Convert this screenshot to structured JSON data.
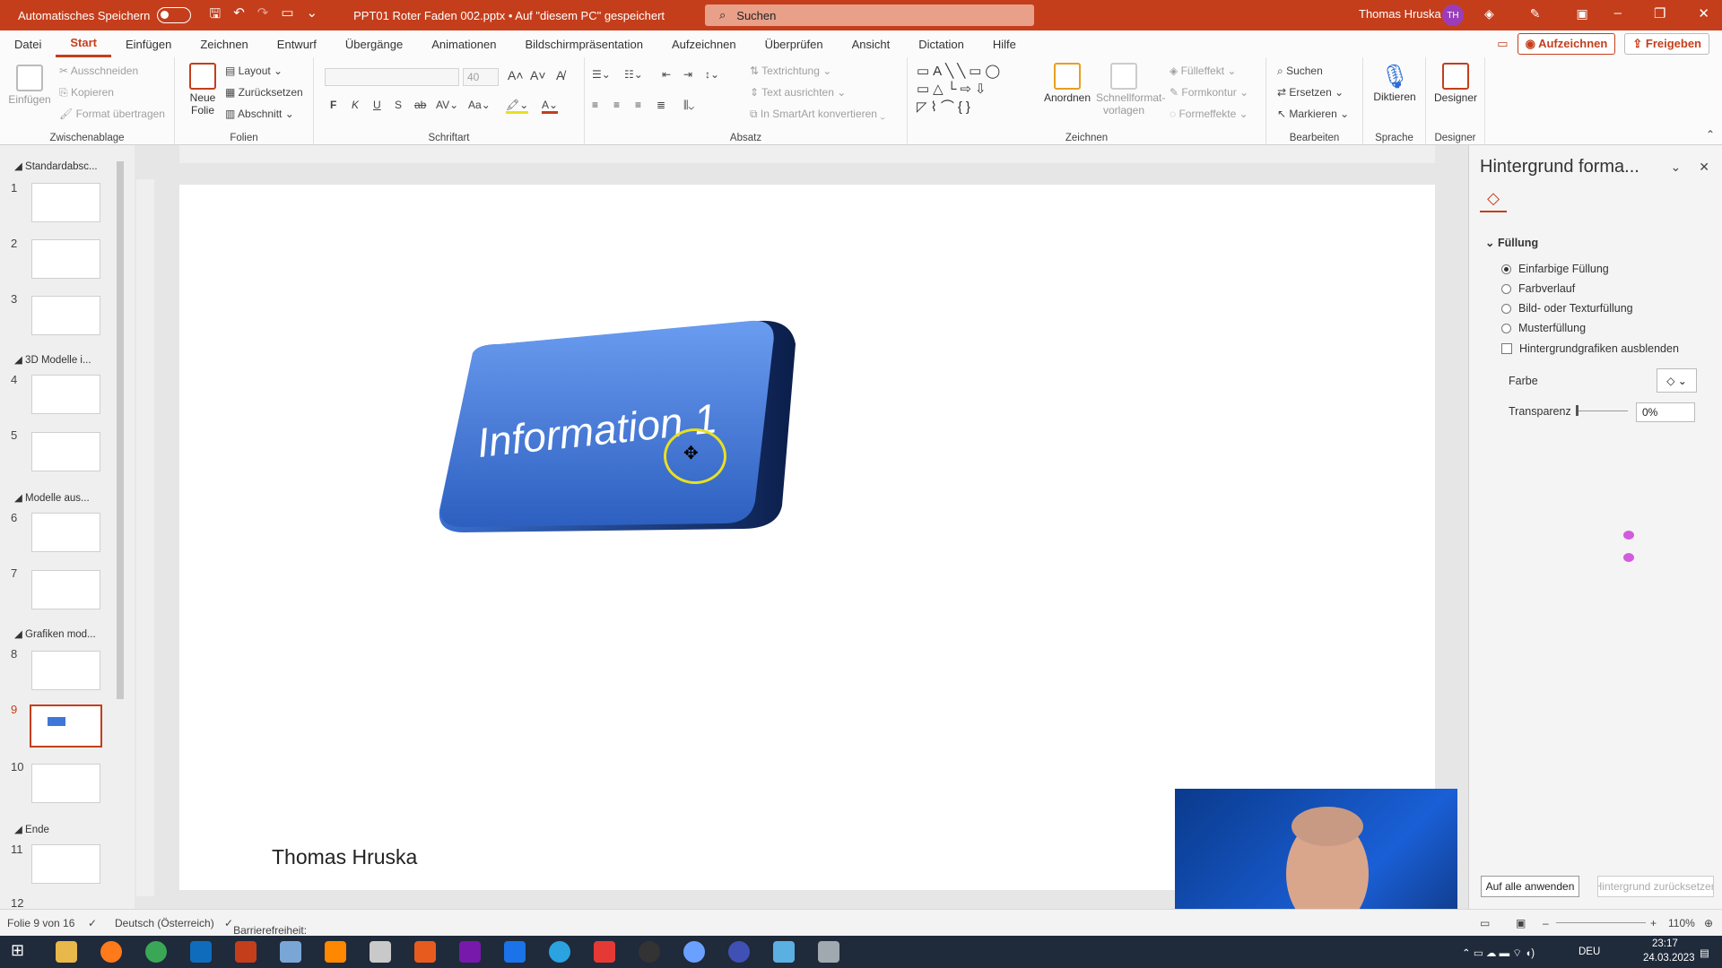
{
  "titlebar": {
    "autosave_label": "Automatisches Speichern",
    "doc_title": "PPT01 Roter Faden 002.pptx • Auf \"diesem PC\" gespeichert",
    "search_placeholder": "Suchen",
    "user_name": "Thomas Hruska",
    "user_initials": "TH"
  },
  "menu": {
    "tabs": [
      "Datei",
      "Start",
      "Einfügen",
      "Zeichnen",
      "Entwurf",
      "Übergänge",
      "Animationen",
      "Bildschirmpräsentation",
      "Aufzeichnen",
      "Überprüfen",
      "Ansicht",
      "Dictation",
      "Hilfe"
    ],
    "record_btn": "Aufzeichnen",
    "share_btn": "Freigeben"
  },
  "ribbon": {
    "clipboard": {
      "label": "Zwischenablage",
      "paste": "Einfügen",
      "cut": "Ausschneiden",
      "copy": "Kopieren",
      "format": "Format übertragen"
    },
    "slides": {
      "label": "Folien",
      "new_slide_1": "Neue",
      "new_slide_2": "Folie",
      "layout": "Layout",
      "reset": "Zurücksetzen",
      "section": "Abschnitt"
    },
    "font": {
      "label": "Schriftart",
      "size": "40",
      "bold": "F",
      "italic": "K",
      "underline": "U",
      "strike": "S",
      "case": "Aa"
    },
    "paragraph": {
      "label": "Absatz",
      "text_dir": "Textrichtung",
      "align_text": "Text ausrichten",
      "smartart": "In SmartArt konvertieren"
    },
    "drawing": {
      "label": "Zeichnen",
      "arrange": "Anordnen",
      "quick_1": "Schnellformat-",
      "quick_2": "vorlagen",
      "fill": "Fülleffekt",
      "outline": "Formkontur",
      "effects": "Formeffekte"
    },
    "editing": {
      "label": "Bearbeiten",
      "find": "Suchen",
      "replace": "Ersetzen",
      "select": "Markieren"
    },
    "voice": {
      "label": "Sprache",
      "dictate": "Diktieren"
    },
    "designer": {
      "label": "Designer",
      "btn": "Designer"
    }
  },
  "slides_panel": {
    "sections": [
      {
        "title": "Standardabsc..."
      },
      {
        "title": "3D Modelle i..."
      },
      {
        "title": "Modelle aus..."
      },
      {
        "title": "Grafiken mod..."
      },
      {
        "title": "Ende"
      }
    ],
    "numbers": [
      "1",
      "2",
      "3",
      "4",
      "5",
      "6",
      "7",
      "8",
      "9",
      "10",
      "11",
      "12"
    ],
    "active_slide": 9
  },
  "slide": {
    "shape_text": "Information 1",
    "author": "Thomas Hruska"
  },
  "format_pane": {
    "title": "Hintergrund forma...",
    "fill_header": "Füllung",
    "options": [
      "Einfarbige Füllung",
      "Farbverlauf",
      "Bild- oder Texturfüllung",
      "Musterfüllung"
    ],
    "selected_option": "Einfarbige Füllung",
    "hide_graphics": "Hintergrundgrafiken ausblenden",
    "color_label": "Farbe",
    "transparency_label": "Transparenz",
    "transparency_value": "0%",
    "apply_all": "Auf alle anwenden",
    "reset_bg": "Hintergrund zurücksetzen"
  },
  "statusbar": {
    "slide_info": "Folie 9 von 16",
    "language": "Deutsch (Österreich)",
    "accessibility": "Barrierefreiheit: Untersuchen",
    "zoom": "110%"
  },
  "taskbar": {
    "lang": "DEU",
    "time": "23:17",
    "date": "24.03.2023"
  },
  "colors": {
    "accent": "#c43e1c",
    "shape_blue": "#3f77d8"
  }
}
